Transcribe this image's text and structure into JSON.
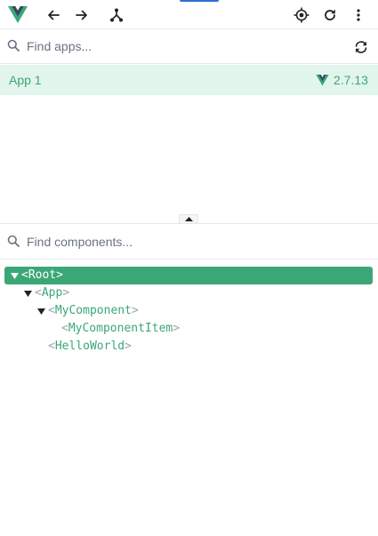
{
  "toolbar": {
    "logo_icon": "vue-logo-icon",
    "back_icon": "arrow-left-icon",
    "forward_icon": "arrow-right-icon",
    "tree_icon": "component-tree-icon",
    "inspect_icon": "crosshair-target-icon",
    "refresh_icon": "refresh-icon",
    "more_icon": "more-vertical-icon",
    "accent_color": "#2f6fd7"
  },
  "apps_search": {
    "placeholder": "Find apps...",
    "value": "",
    "refresh_icon": "sync-icon"
  },
  "apps": [
    {
      "name": "App 1",
      "version": "2.7.13",
      "selected": true
    }
  ],
  "components_search": {
    "placeholder": "Find components...",
    "value": ""
  },
  "tree": [
    {
      "name": "Root",
      "open": "<",
      "close": ">",
      "expanded": true,
      "selected": true,
      "has_children": true
    },
    {
      "name": "App",
      "open": "<",
      "close": ">",
      "expanded": true,
      "selected": false,
      "has_children": true
    },
    {
      "name": "MyComponent",
      "open": "<",
      "close": ">",
      "expanded": true,
      "selected": false,
      "has_children": true
    },
    {
      "name": "MyComponentItem",
      "open": "<",
      "close": ">",
      "expanded": false,
      "selected": false,
      "has_children": false
    },
    {
      "name": "HelloWorld",
      "open": "<",
      "close": ">",
      "expanded": false,
      "selected": false,
      "has_children": false
    }
  ],
  "colors": {
    "vue_green": "#3ba776",
    "vue_dark": "#34495e",
    "selected_row_bg": "#e2f5ec",
    "bracket_gray": "#9ca3af"
  }
}
